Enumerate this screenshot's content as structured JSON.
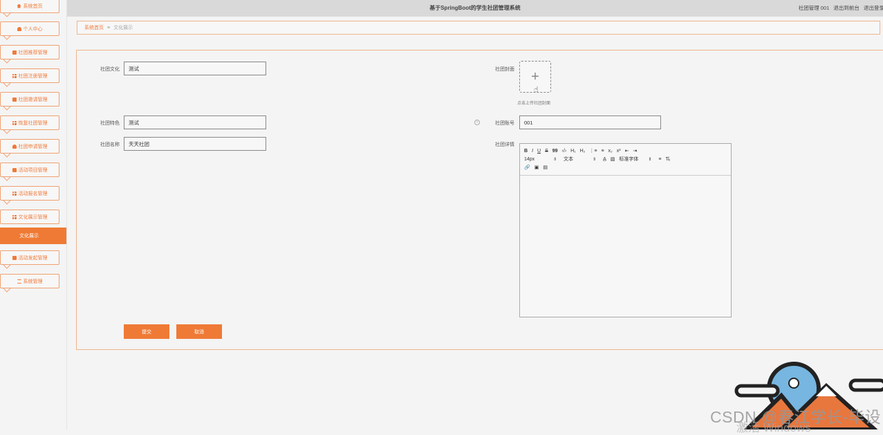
{
  "topbar": {
    "title": "基于SpringBoot的学生社团管理系统",
    "user": "社团管理 001",
    "front_link": "退出到前台",
    "logout": "退出登录"
  },
  "sidebar": {
    "items": [
      {
        "label": "系统首页",
        "icon": "home-icon"
      },
      {
        "label": "个人中心",
        "icon": "person-icon"
      },
      {
        "label": "社团推荐管理",
        "icon": "card-icon"
      },
      {
        "label": "社团注册管理",
        "icon": "grid-icon"
      },
      {
        "label": "社团邀请管理",
        "icon": "bag-icon"
      },
      {
        "label": "恢复社团管理",
        "icon": "grid-icon"
      },
      {
        "label": "社团申请管理",
        "icon": "person-icon"
      },
      {
        "label": "活动项目管理",
        "icon": "card-icon"
      },
      {
        "label": "活动报名管理",
        "icon": "grid-icon"
      },
      {
        "label": "文化展示管理",
        "icon": "grid-icon"
      },
      {
        "label": "活动发起管理",
        "icon": "bag-icon"
      },
      {
        "label": "系统管理",
        "icon": "tune-icon"
      }
    ],
    "active_sub": "文化展示"
  },
  "breadcrumb": {
    "home": "系统首页",
    "separator": "≡",
    "current": "文化展示"
  },
  "form": {
    "culture_label": "社团文化",
    "culture_value": "测试",
    "feature_label": "社团特色",
    "feature_value": "测试",
    "name_label": "社团名称",
    "name_value": "天天社团",
    "cover_label": "社团封面",
    "upload_tip": "点击上传社团封面",
    "account_label": "社团账号",
    "account_value": "001",
    "detail_label": "社团详情"
  },
  "editor": {
    "row1": [
      "B",
      "I",
      "U",
      "S",
      "99",
      "‹/›",
      "H₁",
      "H₂",
      "⋮≡",
      "≡",
      "x₂",
      "x²",
      "⇤",
      "⇥"
    ],
    "font_size": "14px",
    "text_style": "文本",
    "font_family": "标准字体"
  },
  "buttons": {
    "submit": "提交",
    "cancel": "取消"
  },
  "watermark": {
    "text": "CSDN @春江学长-毕设",
    "os": "激活 Windows"
  },
  "colors": {
    "accent": "#ef7a35",
    "border": "#f0b48a"
  }
}
